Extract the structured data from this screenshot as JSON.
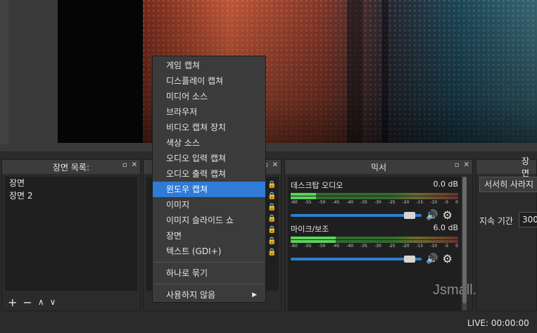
{
  "scenes": {
    "title": "장면 목록:",
    "items": [
      "장면",
      "장면 2"
    ],
    "toolbar": [
      "+",
      "−",
      "∧",
      "∨"
    ]
  },
  "mixer": {
    "title": "믹서",
    "channels": [
      {
        "name": "데스크탑 오디오",
        "db": "0.0 dB",
        "level": 0.15,
        "volume": 0.95
      },
      {
        "name": "마이크/보조",
        "db": "6.0 dB",
        "level": 0.27,
        "volume": 0.95
      }
    ],
    "scale_ticks": [
      "-60",
      "-55",
      "-50",
      "-45",
      "-40",
      "-35",
      "-30",
      "-25",
      "-20",
      "-15",
      "-10",
      "-5",
      "0"
    ]
  },
  "transitions": {
    "title": "장면",
    "transition_value": "서서히 사라지",
    "duration_label": "지속 기간",
    "duration_value": "300"
  },
  "context_menu": {
    "items": [
      {
        "label": "게임 캡쳐",
        "selected": false
      },
      {
        "label": "디스플레이 캡쳐",
        "selected": false
      },
      {
        "label": "미디어 소스",
        "selected": false
      },
      {
        "label": "브라우저",
        "selected": false
      },
      {
        "label": "비디오 캡쳐 장치",
        "selected": false
      },
      {
        "label": "색상 소스",
        "selected": false
      },
      {
        "label": "오디오 입력 캡쳐",
        "selected": false
      },
      {
        "label": "오디오 출력 캡쳐",
        "selected": false
      },
      {
        "label": "윈도우 캡쳐",
        "selected": true
      },
      {
        "label": "이미지",
        "selected": false
      },
      {
        "label": "이미지 슬라이드 쇼",
        "selected": false
      },
      {
        "label": "장면",
        "selected": false
      },
      {
        "label": "텍스트 (GDI+)",
        "selected": false
      }
    ],
    "group_label": "하나로 묶기",
    "deprecated_label": "사용하지 않음"
  },
  "status": {
    "live": "LIVE: 00:00:00"
  },
  "watermark": "Jsmall.net",
  "colors": {
    "selection": "#2f7bd6",
    "slider": "#2d7fd0",
    "meter_green": "#5ad35a"
  }
}
